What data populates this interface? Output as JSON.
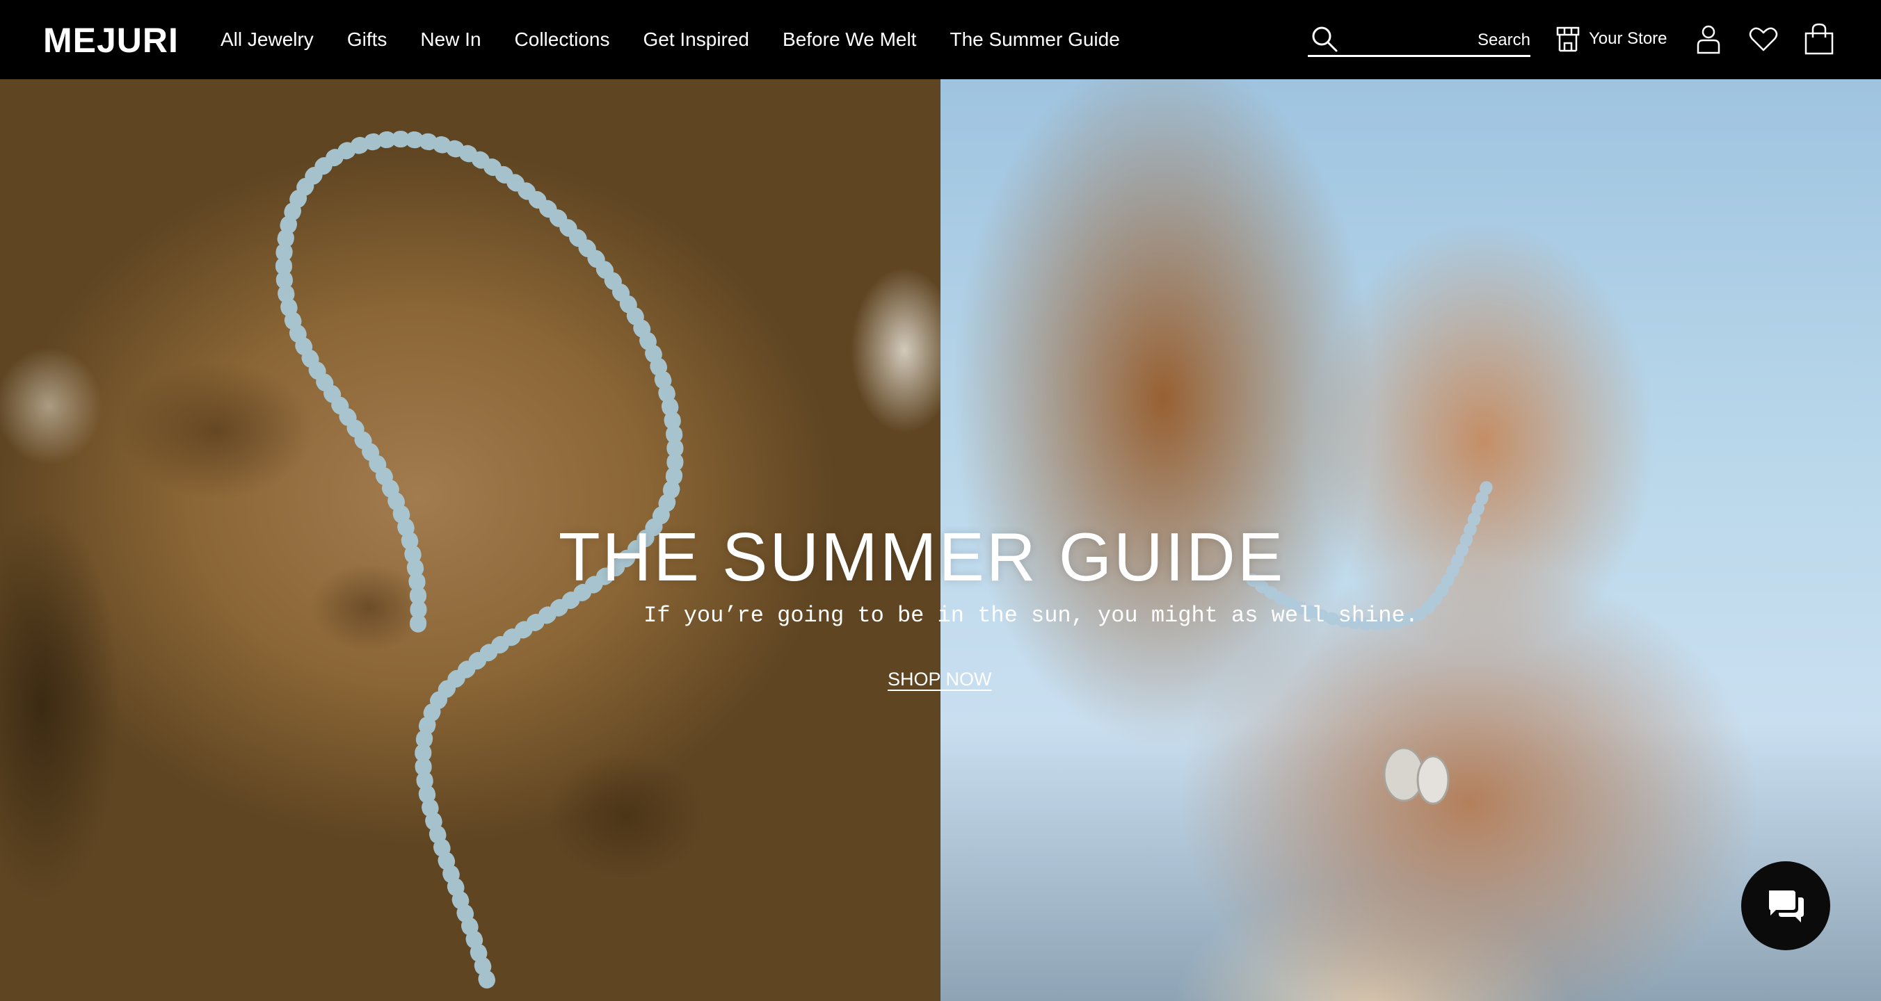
{
  "header": {
    "logo": "MEJURI",
    "nav": [
      {
        "label": "All Jewelry"
      },
      {
        "label": "Gifts"
      },
      {
        "label": "New In"
      },
      {
        "label": "Collections"
      },
      {
        "label": "Get Inspired"
      },
      {
        "label": "Before We Melt"
      },
      {
        "label": "The Summer Guide"
      }
    ],
    "search": {
      "label": "Search",
      "placeholder": "",
      "icon": "search-icon"
    },
    "store_label": "Your Store",
    "icons": [
      "store-icon",
      "account-icon",
      "heart-icon",
      "bag-icon"
    ]
  },
  "hero": {
    "title": "THE SUMMER GUIDE",
    "subtitle": "If you’re going to be in the sun, you might as well shine.",
    "cta": "SHOP NOW"
  },
  "chat": {
    "icon": "chat-icon"
  },
  "colors": {
    "header_bg": "#000000",
    "text": "#ffffff",
    "chat_bg": "#0b0b0b"
  }
}
